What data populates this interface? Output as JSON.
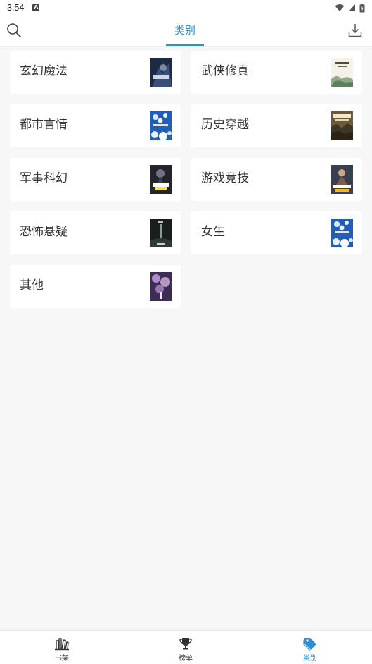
{
  "status_bar": {
    "time": "3:54",
    "notification_icon": "A"
  },
  "header": {
    "title": "类别",
    "search_icon": "search-icon",
    "download_icon": "download-icon",
    "accent_color": "#2d8fd5"
  },
  "categories": [
    {
      "label": "玄幻魔法",
      "cover": "dark-blue-fantasy-cover"
    },
    {
      "label": "武侠修真",
      "cover": "ink-landscape-cover"
    },
    {
      "label": "都市言情",
      "cover": "blue-flowers-cover"
    },
    {
      "label": "历史穿越",
      "cover": "war-battle-cover"
    },
    {
      "label": "军事科幻",
      "cover": "dark-warrior-cover"
    },
    {
      "label": "游戏竞技",
      "cover": "game-hero-cover"
    },
    {
      "label": "恐怖悬疑",
      "cover": "dark-mystery-cover"
    },
    {
      "label": "女生",
      "cover": "blue-flowers-cover"
    },
    {
      "label": "其他",
      "cover": "purple-fantasy-cover"
    }
  ],
  "tabbar": {
    "tabs": [
      {
        "label": "书架",
        "icon": "bookshelf-icon",
        "active": false
      },
      {
        "label": "榜单",
        "icon": "trophy-icon",
        "active": false
      },
      {
        "label": "类别",
        "icon": "tag-icon",
        "active": true
      }
    ]
  }
}
